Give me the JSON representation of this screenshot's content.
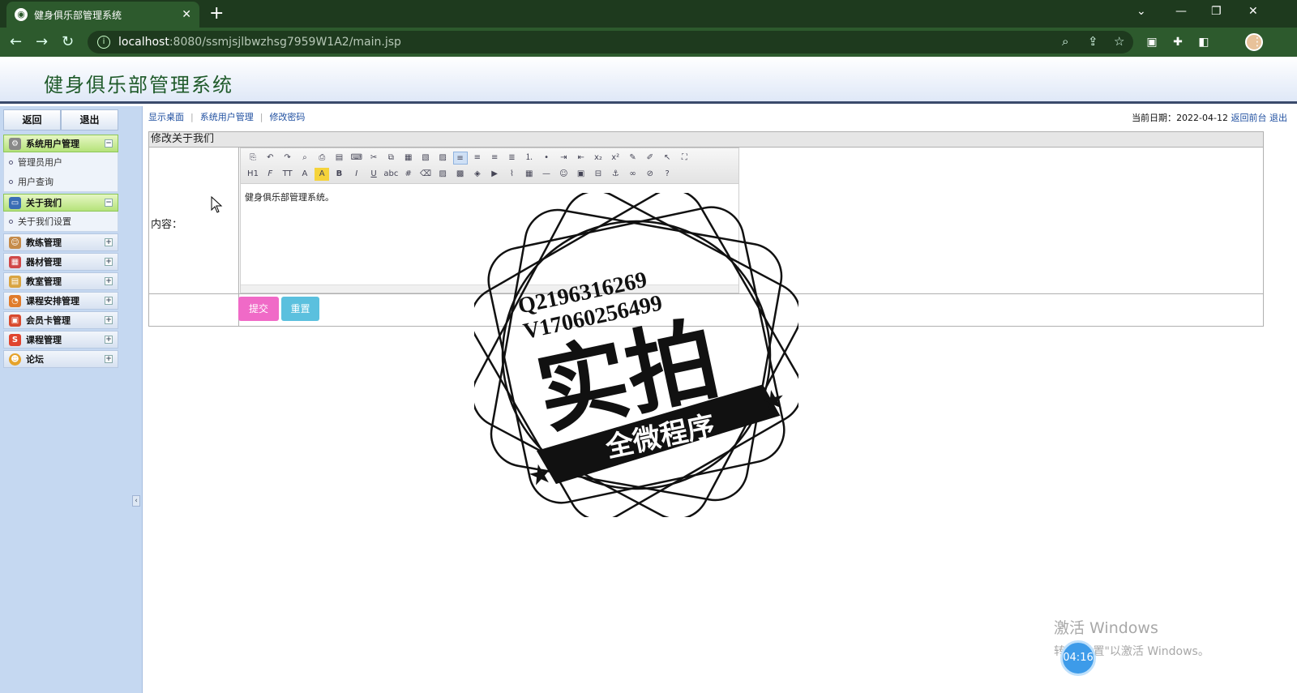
{
  "browser": {
    "tab_title": "健身俱乐部管理系统",
    "url_host": "localhost",
    "url_path": ":8080/ssmjsjlbwzhsg7959W1A2/main.jsp",
    "icons": [
      "back-icon",
      "forward-icon",
      "reload-icon",
      "info-icon",
      "zoom-icon",
      "share-icon",
      "star-icon",
      "extension-icon",
      "puzzle-icon",
      "sidepanel-icon",
      "profile-avatar",
      "menu-icon"
    ]
  },
  "header": {
    "title": "健身俱乐部管理系统"
  },
  "sidebar": {
    "back_label": "返回",
    "exit_label": "退出",
    "sections": [
      {
        "label": "系统用户管理",
        "icon": "gear-icon",
        "expanded": true,
        "items": [
          "管理员用户",
          "用户查询"
        ]
      },
      {
        "label": "关于我们",
        "icon": "monitor-icon",
        "expanded": true,
        "items": [
          "关于我们设置"
        ]
      },
      {
        "label": "教练管理",
        "icon": "person-icon",
        "expanded": false,
        "items": []
      },
      {
        "label": "器材管理",
        "icon": "calendar-icon",
        "expanded": false,
        "items": []
      },
      {
        "label": "教室管理",
        "icon": "box-icon",
        "expanded": false,
        "items": []
      },
      {
        "label": "课程安排管理",
        "icon": "schedule-icon",
        "expanded": false,
        "items": []
      },
      {
        "label": "会员卡管理",
        "icon": "card-icon",
        "expanded": false,
        "items": []
      },
      {
        "label": "课程管理",
        "icon": "course-icon",
        "expanded": false,
        "items": []
      },
      {
        "label": "论坛",
        "icon": "forum-icon",
        "expanded": false,
        "items": []
      }
    ]
  },
  "topnav": {
    "items": [
      "显示桌面",
      "系统用户管理",
      "修改密码"
    ],
    "date_label": "当前日期：",
    "date_value": "2022-04-12",
    "back_front": "返回前台",
    "logout": "退出"
  },
  "form": {
    "caption": "修改关于我们",
    "content_label": "内容：",
    "editor_text": "健身俱乐部管理系统。",
    "submit_label": "提交",
    "reset_label": "重置"
  },
  "watermark": {
    "line1": "Q2196316269",
    "line2": "V17060256499",
    "big": "实拍",
    "banner": "全微程序"
  },
  "os": {
    "activate_title": "激活 Windows",
    "activate_sub": "转到\"设置\"以激活 Windows。",
    "timer": "04:16"
  },
  "colors": {
    "chrome": "#2d5a2d",
    "sidebar_bg": "#c5d8f1",
    "active_menu": "#b5e27a",
    "submit": "#f06ac7",
    "reset": "#5bc0de",
    "title": "#1f5a2a"
  }
}
